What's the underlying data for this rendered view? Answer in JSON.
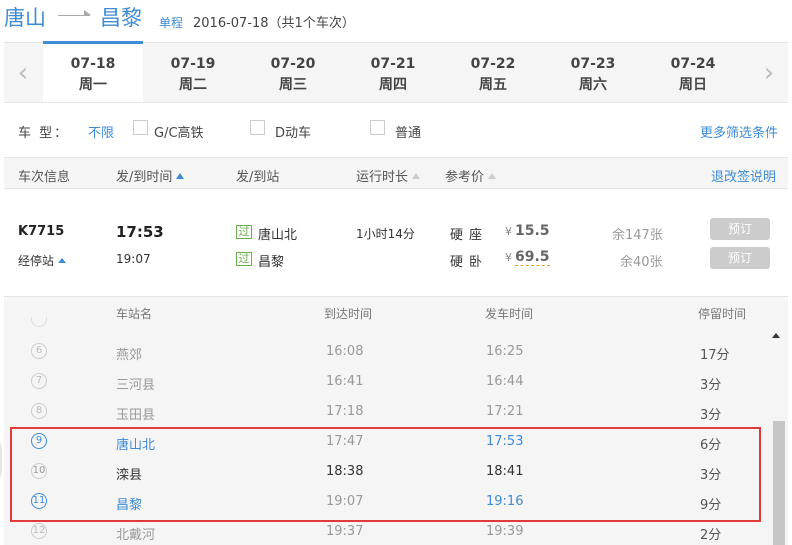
{
  "header": {
    "from_city": "唐山",
    "to_city": "昌黎",
    "trip_type": "单程",
    "trip_info": "2016-07-18（共1个车次）"
  },
  "dates": [
    {
      "date": "07-18",
      "weekday": "周一",
      "active": true
    },
    {
      "date": "07-19",
      "weekday": "周二"
    },
    {
      "date": "07-20",
      "weekday": "周三"
    },
    {
      "date": "07-21",
      "weekday": "周四"
    },
    {
      "date": "07-22",
      "weekday": "周五"
    },
    {
      "date": "07-23",
      "weekday": "周六"
    },
    {
      "date": "07-24",
      "weekday": "周日"
    }
  ],
  "filters": {
    "type_label": "车 型：",
    "type_value": "不限",
    "options": [
      "G/C高铁",
      "D动车",
      "普通"
    ],
    "more": "更多筛选条件"
  },
  "list_header": {
    "train_info": "车次信息",
    "time": "发/到时间",
    "station": "发/到站",
    "duration": "运行时长",
    "price": "参考价",
    "refund": "退改签说明"
  },
  "train": {
    "number": "K7715",
    "stops_label": "经停站",
    "dep_time": "17:53",
    "arr_time": "19:07",
    "dep_tag": "过",
    "arr_tag": "过",
    "dep_station": "唐山北",
    "arr_station": "昌黎",
    "duration": "1小时14分",
    "seats": [
      {
        "type": "硬座",
        "currency": "¥",
        "price": "15.5",
        "remain": "余147张",
        "book": "预订"
      },
      {
        "type": "硬卧",
        "currency": "¥",
        "price": "69.5",
        "remain": "余40张",
        "book": "预订"
      }
    ]
  },
  "stops_header": {
    "name": "车站名",
    "arrive": "到达时间",
    "depart": "发车时间",
    "stay": "停留时间"
  },
  "stops": [
    {
      "idx": "6",
      "name": "燕郊",
      "arrive": "16:08",
      "depart": "16:25",
      "stay": "17分"
    },
    {
      "idx": "7",
      "name": "三河县",
      "arrive": "16:41",
      "depart": "16:44",
      "stay": "3分"
    },
    {
      "idx": "8",
      "name": "玉田县",
      "arrive": "17:18",
      "depart": "17:21",
      "stay": "3分"
    },
    {
      "idx": "9",
      "name": "唐山北",
      "arrive": "17:47",
      "depart": "17:53",
      "stay": "6分",
      "hl": true
    },
    {
      "idx": "10",
      "name": "滦县",
      "arrive": "18:38",
      "depart": "18:41",
      "stay": "3分",
      "mid": true
    },
    {
      "idx": "11",
      "name": "昌黎",
      "arrive": "19:07",
      "depart": "19:16",
      "stay": "9分",
      "hl": true
    },
    {
      "idx": "12",
      "name": "北戴河",
      "arrive": "19:37",
      "depart": "19:39",
      "stay": "2分"
    }
  ]
}
